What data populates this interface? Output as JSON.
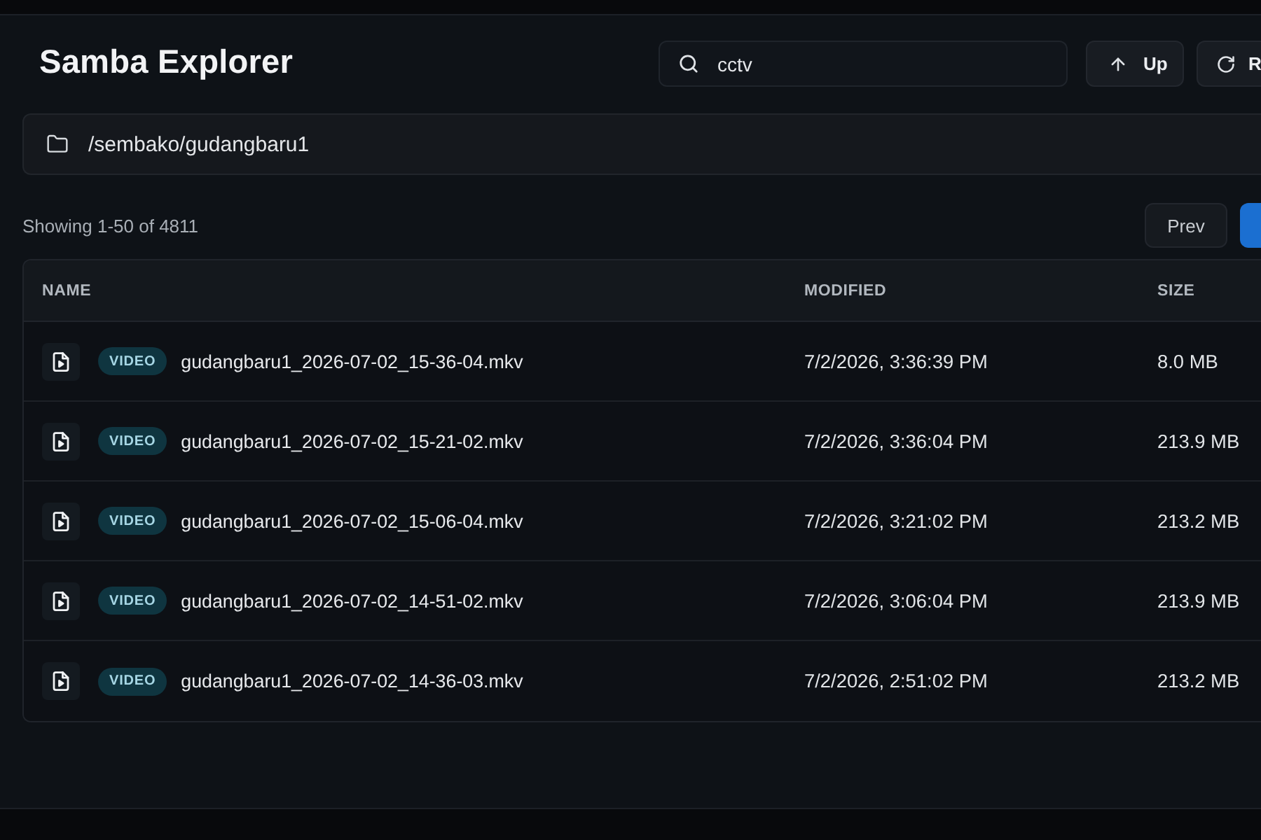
{
  "header": {
    "title": "Samba Explorer",
    "search": {
      "value": "cctv"
    },
    "buttons": [
      {
        "kind": "up",
        "label": "Up"
      },
      {
        "kind": "refresh",
        "label": "R"
      }
    ]
  },
  "path_bar": {
    "path": "/sembako/gudangbaru1"
  },
  "pagination": {
    "summary": "Showing 1-50 of 4811",
    "buttons": [
      {
        "kind": "secondary",
        "label": "Prev"
      },
      {
        "kind": "primary"
      }
    ]
  },
  "table": {
    "columns": [
      "NAME",
      "MODIFIED",
      "SIZE"
    ],
    "rows": [
      {
        "type": "VIDEO",
        "name": "gudangbaru1_2026-07-02_15-36-04.mkv",
        "modified": "7/2/2026, 3:36:39 PM",
        "size": "8.0 MB"
      },
      {
        "type": "VIDEO",
        "name": "gudangbaru1_2026-07-02_15-21-02.mkv",
        "modified": "7/2/2026, 3:36:04 PM",
        "size": "213.9 MB"
      },
      {
        "type": "VIDEO",
        "name": "gudangbaru1_2026-07-02_15-06-04.mkv",
        "modified": "7/2/2026, 3:21:02 PM",
        "size": "213.2 MB"
      },
      {
        "type": "VIDEO",
        "name": "gudangbaru1_2026-07-02_14-51-02.mkv",
        "modified": "7/2/2026, 3:06:04 PM",
        "size": "213.9 MB"
      },
      {
        "type": "VIDEO",
        "name": "gudangbaru1_2026-07-02_14-36-03.mkv",
        "modified": "7/2/2026, 2:51:02 PM",
        "size": "213.2 MB"
      }
    ]
  }
}
